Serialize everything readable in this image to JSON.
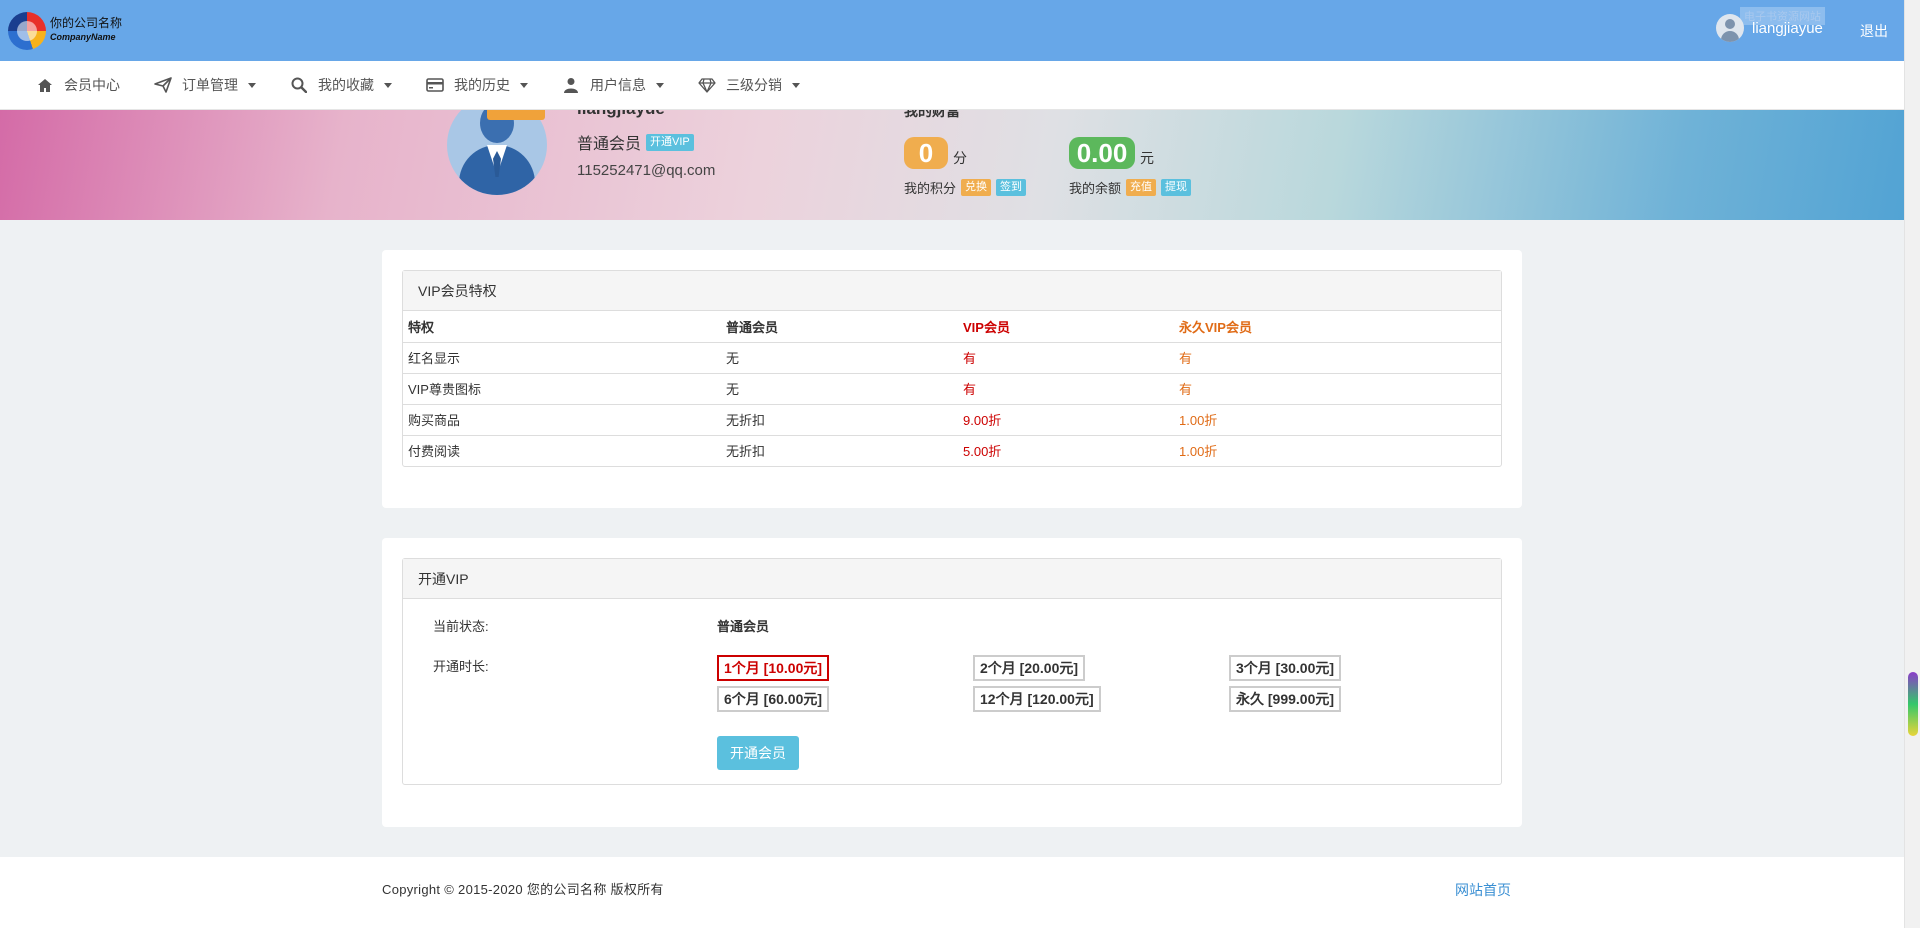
{
  "topbar": {
    "company_cn": "你的公司名称",
    "company_en": "CompanyName",
    "username": "liangjiayue",
    "ghost_text": "电子书资源网站",
    "logout": "退出"
  },
  "nav": [
    {
      "label": "会员中心",
      "icon": "home-icon",
      "caret": false
    },
    {
      "label": "订单管理",
      "icon": "paper-plane-icon",
      "caret": true
    },
    {
      "label": "我的收藏",
      "icon": "search-icon",
      "caret": true
    },
    {
      "label": "我的历史",
      "icon": "credit-card-icon",
      "caret": true
    },
    {
      "label": "用户信息",
      "icon": "user-icon",
      "caret": true
    },
    {
      "label": "三级分销",
      "icon": "diamond-icon",
      "caret": true
    }
  ],
  "profile": {
    "name": "liangjiayue",
    "level": "普通会员",
    "open_vip_badge": "开通VIP",
    "email": "115252471@qq.com",
    "account_title": "我的财富"
  },
  "points": {
    "value": "0",
    "unit": "分",
    "label": "我的积分",
    "btn1": "兑换",
    "btn2": "签到"
  },
  "balance": {
    "value": "0.00",
    "unit": "元",
    "label": "我的余额",
    "btn1": "充值",
    "btn2": "提现"
  },
  "privileges": {
    "title": "VIP会员特权",
    "headers": [
      "特权",
      "普通会员",
      "VIP会员",
      "永久VIP会员"
    ],
    "rows": [
      [
        "红名显示",
        "无",
        "有",
        "有"
      ],
      [
        "VIP尊贵图标",
        "无",
        "有",
        "有"
      ],
      [
        "购买商品",
        "无折扣",
        "9.00折",
        "1.00折"
      ],
      [
        "付费阅读",
        "无折扣",
        "5.00折",
        "1.00折"
      ]
    ]
  },
  "open_vip": {
    "title": "开通VIP",
    "status_label": "当前状态:",
    "status_value": "普通会员",
    "duration_label": "开通时长:",
    "options": [
      "1个月 [10.00元]",
      "2个月 [20.00元]",
      "3个月 [30.00元]",
      "6个月 [60.00元]",
      "12个月 [120.00元]",
      "永久 [999.00元]"
    ],
    "selected_index": 0,
    "submit": "开通会员"
  },
  "footer": {
    "copyright": "Copyright © 2015-2020 您的公司名称 版权所有",
    "home_link": "网站首页"
  },
  "colors": {
    "topbar": "#67a7e8",
    "info": "#5bc0de",
    "warning": "#f0ad4e",
    "vip_red": "#cc0000",
    "forever_orange": "#e06b16",
    "points_bg": "#f0ad4e",
    "balance_bg": "#5cb85c"
  }
}
